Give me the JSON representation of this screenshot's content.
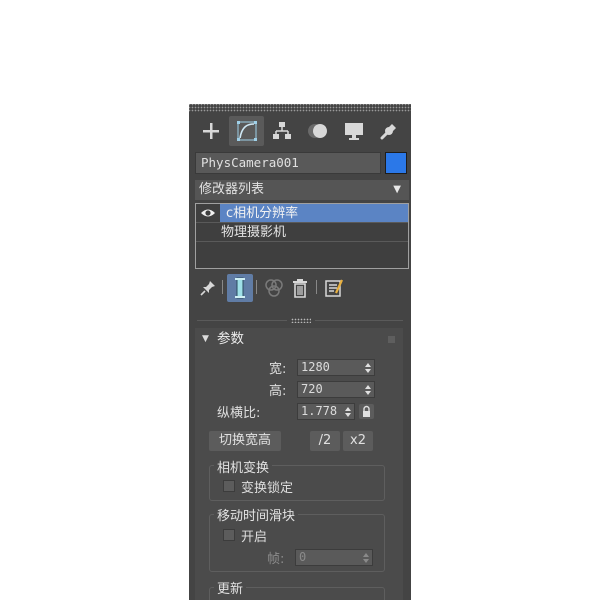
{
  "tabs": [
    {
      "icon": "create-plus-icon"
    },
    {
      "icon": "modify-curve-icon",
      "active": true
    },
    {
      "icon": "hierarchy-icon"
    },
    {
      "icon": "motion-icon"
    },
    {
      "icon": "display-monitor-icon"
    },
    {
      "icon": "utilities-wrench-icon"
    }
  ],
  "object": {
    "name": "PhysCamera001",
    "color": "#2b78e8"
  },
  "modifier_list": {
    "label": "修改器列表"
  },
  "stack": [
    {
      "label": "c相机分辨率",
      "selected": true
    },
    {
      "label": "物理摄影机",
      "selected": false
    }
  ],
  "stack_toolbar": {
    "icons": [
      "pin-stack-icon",
      "show-end-result-icon",
      "make-unique-icon",
      "remove-modifier-icon",
      "configure-sets-icon"
    ]
  },
  "rollout": {
    "title": "参数",
    "width_label": "宽:",
    "width_value": "1280",
    "height_label": "高:",
    "height_value": "720",
    "aspect_label": "纵横比:",
    "aspect_value": "1.778",
    "swap_button": "切换宽高",
    "half_button": "/2",
    "double_button": "x2",
    "camera_transform": {
      "title": "相机变换",
      "lock_label": "变换锁定"
    },
    "time_slider": {
      "title": "移动时间滑块",
      "enable_label": "开启",
      "frame_label": "帧:",
      "frame_value": "0"
    },
    "update": {
      "title": "更新"
    }
  }
}
